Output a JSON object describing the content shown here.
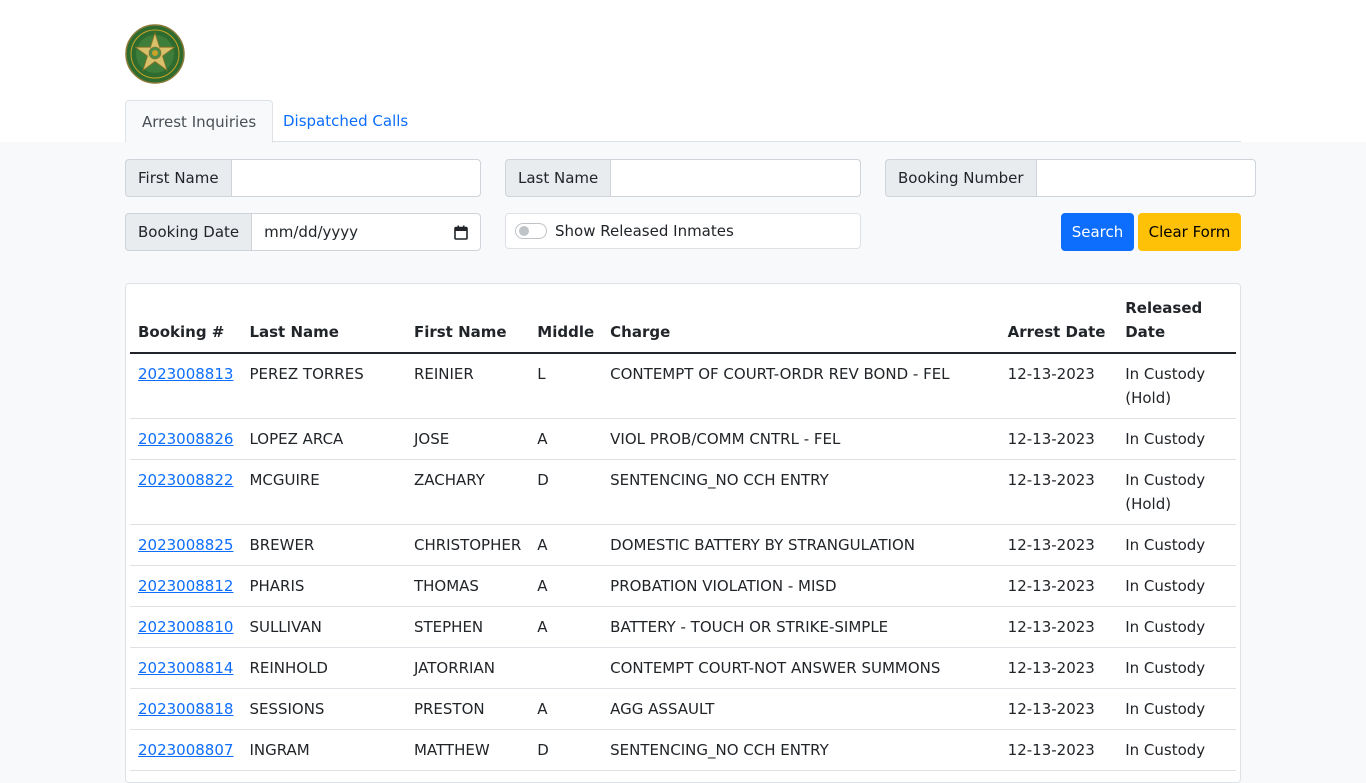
{
  "tabs": [
    {
      "label": "Arrest Inquiries"
    },
    {
      "label": "Dispatched Calls"
    }
  ],
  "search": {
    "first_name_label": "First Name",
    "first_name_value": "",
    "last_name_label": "Last Name",
    "last_name_value": "",
    "booking_number_label": "Booking Number",
    "booking_number_value": "",
    "booking_date_label": "Booking Date",
    "booking_date_placeholder": "mm/dd/yyyy",
    "show_released_label": "Show Released Inmates",
    "show_released_checked": false,
    "search_button": "Search",
    "clear_button": "Clear Form"
  },
  "table": {
    "headers": [
      "Booking #",
      "Last Name",
      "First Name",
      "Middle",
      "Charge",
      "Arrest Date",
      "Released Date"
    ],
    "rows": [
      {
        "booking": "2023008813",
        "last": "PEREZ TORRES",
        "first": "REINIER",
        "middle": "L",
        "charge": "CONTEMPT OF COURT-ORDR REV BOND - FEL",
        "arrest_date": "12-13-2023",
        "released": "In Custody (Hold)"
      },
      {
        "booking": "2023008826",
        "last": "LOPEZ ARCA",
        "first": "JOSE",
        "middle": "A",
        "charge": "VIOL PROB/COMM CNTRL - FEL",
        "arrest_date": "12-13-2023",
        "released": "In Custody"
      },
      {
        "booking": "2023008822",
        "last": "MCGUIRE",
        "first": "ZACHARY",
        "middle": "D",
        "charge": "SENTENCING_NO CCH ENTRY",
        "arrest_date": "12-13-2023",
        "released": "In Custody (Hold)"
      },
      {
        "booking": "2023008825",
        "last": "BREWER",
        "first": "CHRISTOPHER",
        "middle": "A",
        "charge": "DOMESTIC BATTERY BY STRANGULATION",
        "arrest_date": "12-13-2023",
        "released": "In Custody"
      },
      {
        "booking": "2023008812",
        "last": "PHARIS",
        "first": "THOMAS",
        "middle": "A",
        "charge": "PROBATION VIOLATION - MISD",
        "arrest_date": "12-13-2023",
        "released": "In Custody"
      },
      {
        "booking": "2023008810",
        "last": "SULLIVAN",
        "first": "STEPHEN",
        "middle": "A",
        "charge": "BATTERY - TOUCH OR STRIKE-SIMPLE",
        "arrest_date": "12-13-2023",
        "released": "In Custody"
      },
      {
        "booking": "2023008814",
        "last": "REINHOLD",
        "first": "JATORRIAN",
        "middle": "",
        "charge": "CONTEMPT COURT-NOT ANSWER SUMMONS",
        "arrest_date": "12-13-2023",
        "released": "In Custody"
      },
      {
        "booking": "2023008818",
        "last": "SESSIONS",
        "first": "PRESTON",
        "middle": "A",
        "charge": "AGG ASSAULT",
        "arrest_date": "12-13-2023",
        "released": "In Custody"
      },
      {
        "booking": "2023008807",
        "last": "INGRAM",
        "first": "MATTHEW",
        "middle": "D",
        "charge": "SENTENCING_NO CCH ENTRY",
        "arrest_date": "12-13-2023",
        "released": "In Custody"
      }
    ]
  },
  "colors": {
    "primary": "#0d6efd",
    "warning": "#ffc107",
    "badge_green": "#2e6b2e",
    "badge_gold": "#c9a227"
  }
}
